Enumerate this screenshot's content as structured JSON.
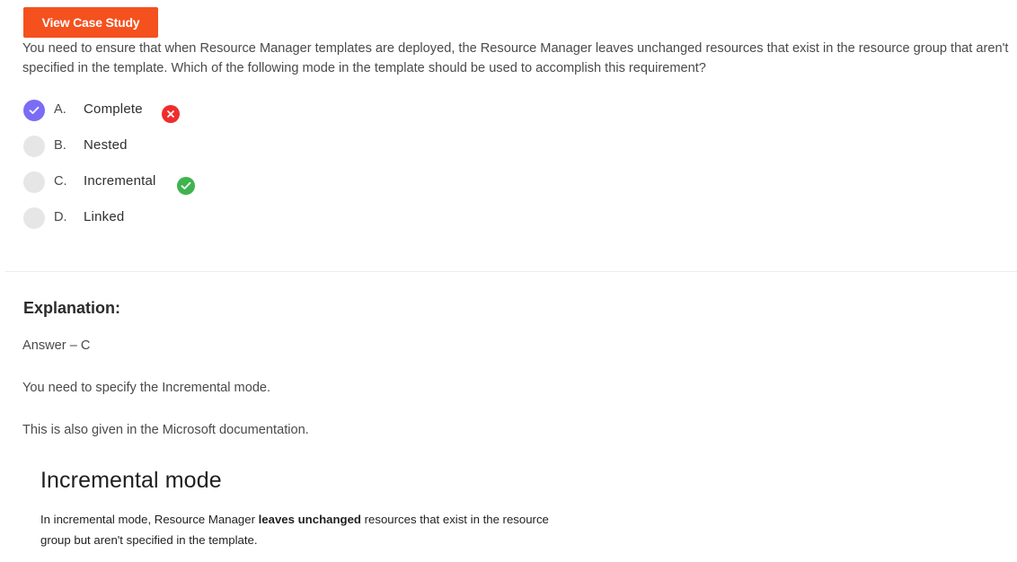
{
  "case_study_button": "View Case Study",
  "question": "You need to ensure that when Resource Manager templates are deployed, the Resource Manager leaves unchanged resources that exist in the resource group that aren't specified in the template. Which of the following mode in the template should be used to accomplish this requirement?",
  "options": [
    {
      "letter": "A.",
      "text": "Complete",
      "selected": true,
      "status": "incorrect"
    },
    {
      "letter": "B.",
      "text": "Nested",
      "selected": false,
      "status": "none"
    },
    {
      "letter": "C.",
      "text": "Incremental",
      "selected": false,
      "status": "correct"
    },
    {
      "letter": "D.",
      "text": "Linked",
      "selected": false,
      "status": "none"
    }
  ],
  "explanation": {
    "heading": "Explanation:",
    "answer": "Answer – C",
    "line1": "You need to specify the Incremental mode.",
    "line2": "This is also given in the Microsoft documentation."
  },
  "doc_excerpt": {
    "heading": "Incremental mode",
    "text_before": "In incremental mode, Resource Manager ",
    "text_bold": "leaves unchanged",
    "text_after": " resources that exist in the resource group but aren't specified in the template."
  },
  "colors": {
    "button": "#f4511e",
    "selected_radio": "#7b6cf6",
    "incorrect": "#ef2d2d",
    "correct": "#3fb34f"
  },
  "icons": {
    "selected": "check-icon",
    "incorrect": "x-circle-icon",
    "correct": "check-circle-icon"
  }
}
